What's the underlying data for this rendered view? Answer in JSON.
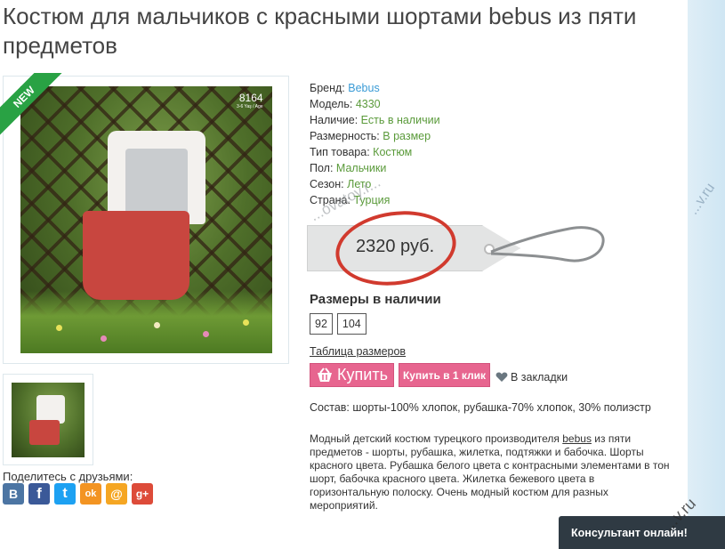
{
  "product": {
    "title": "Костюм для мальчиков с красными шортами bebus из пяти предметов",
    "badge": "NEW",
    "photo_code": "8164",
    "photo_age": "3-6 Yaş / Age"
  },
  "info_rows": [
    {
      "label": "Бренд:",
      "value": "Bebus",
      "style": "link"
    },
    {
      "label": "Модель:",
      "value": "4330",
      "style": "green"
    },
    {
      "label": "Наличие:",
      "value": "Есть в наличии",
      "style": "green"
    },
    {
      "label": "Размерность:",
      "value": "В размер",
      "style": "green"
    },
    {
      "label": "Тип товара:",
      "value": "Костюм",
      "style": "green"
    },
    {
      "label": "Пол:",
      "value": "Мальчики",
      "style": "green"
    },
    {
      "label": "Сезон:",
      "value": "Лето",
      "style": "green"
    },
    {
      "label": "Страна:",
      "value": "Турция",
      "style": "green"
    }
  ],
  "price": "2320 руб.",
  "sizes": {
    "title": "Размеры в наличии",
    "items": [
      "92",
      "104"
    ],
    "table_link": "Таблица размеров"
  },
  "actions": {
    "buy": "Купить",
    "buy_one_click": "Купить в 1 клик",
    "bookmark": "В закладки"
  },
  "composition": "Состав: шорты-100% хлопок, рубашка-70% хлопок, 30% полиэстр",
  "description": {
    "before": "Модный детский костюм турецкого производителя ",
    "brand_link": "bebus",
    "after": " из пяти предметов - шорты, рубашка, жилетка, подтяжки и бабочка. Шорты красного цвета. Рубашка белого цвета с контрасными элементами в тон шорт, бабочка красного цвета. Жилетка бежевого цвета в горизонтальную полоску. Очень модный костюм для разных мероприятий."
  },
  "share": {
    "title": "Поделитесь с друзьями:",
    "networks": [
      {
        "icon": "vk-icon",
        "glyph": "B",
        "color": "#4c75a3"
      },
      {
        "icon": "facebook-icon",
        "glyph": "f",
        "color": "#3b5998"
      },
      {
        "icon": "twitter-icon",
        "glyph": "t",
        "color": "#1da1f2"
      },
      {
        "icon": "odnoklassniki-icon",
        "glyph": "ok",
        "color": "#f39422"
      },
      {
        "icon": "mailru-icon",
        "glyph": "@",
        "color": "#f5a623"
      },
      {
        "icon": "googleplus-icon",
        "glyph": "g+",
        "color": "#dd4b39"
      }
    ]
  },
  "consultant": "Консультант онлайн!",
  "watermarks": [
    "...v.ru",
    "...ovatoy.r...",
    "...v.ru"
  ],
  "colors": {
    "accent_pink": "#e7658f",
    "link_blue": "#3a9bd6",
    "value_green": "#5a9a3a",
    "badge_green": "#29a244",
    "circle_red": "#d13a2e"
  }
}
